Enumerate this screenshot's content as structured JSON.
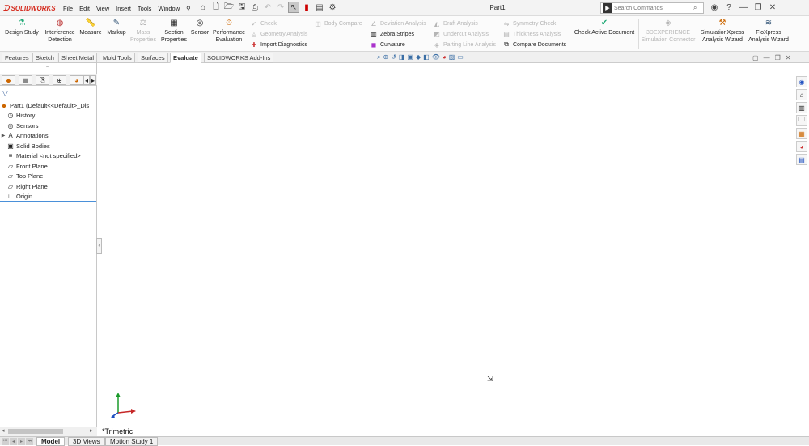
{
  "app": {
    "logo": "SOLIDWORKS",
    "doc_title": "Part1"
  },
  "menu": [
    "File",
    "Edit",
    "View",
    "Insert",
    "Tools",
    "Window"
  ],
  "search": {
    "placeholder": "Search Commands"
  },
  "ribbon": {
    "design_study": "Design Study",
    "interference": "Interference Detection",
    "measure": "Measure",
    "markup": "Markup",
    "mass_properties": "Mass Properties",
    "section_properties": "Section Properties",
    "sensor": "Sensor",
    "performance": "Performance Evaluation",
    "check": "Check",
    "geometry_analysis": "Geometry Analysis",
    "import_diagnostics": "Import Diagnostics",
    "body_compare": "Body Compare",
    "deviation_analysis": "Deviation Analysis",
    "zebra_stripes": "Zebra Stripes",
    "curvature": "Curvature",
    "draft_analysis": "Draft Analysis",
    "undercut_analysis": "Undercut Analysis",
    "parting_line_analysis": "Parting Line Analysis",
    "symmetry_check": "Symmetry Check",
    "thickness_analysis": "Thickness Analysis",
    "compare_documents": "Compare Documents",
    "check_active_document": "Check Active Document",
    "3dexperience": "3DEXPERIENCE Simulation Connector",
    "simxpress": "SimulationXpress Analysis Wizard",
    "floxpress": "FloXpress Analysis Wizard"
  },
  "tabs": [
    "Features",
    "Sketch",
    "Sheet Metal",
    "Mold Tools",
    "Surfaces",
    "Evaluate",
    "SOLIDWORKS Add-Ins"
  ],
  "active_tab": "Evaluate",
  "tree": {
    "root": "Part1  (Default<<Default>_Dis",
    "items": [
      "History",
      "Sensors",
      "Annotations",
      "Solid Bodies",
      "Material <not specified>",
      "Front Plane",
      "Top Plane",
      "Right Plane",
      "Origin"
    ]
  },
  "viewport": {
    "view_name": "*Trimetric"
  },
  "bottom_tabs": [
    "Model",
    "3D Views",
    "Motion Study 1"
  ],
  "colors": {
    "brand": "#d52b1e",
    "accent": "#4a90d9"
  }
}
